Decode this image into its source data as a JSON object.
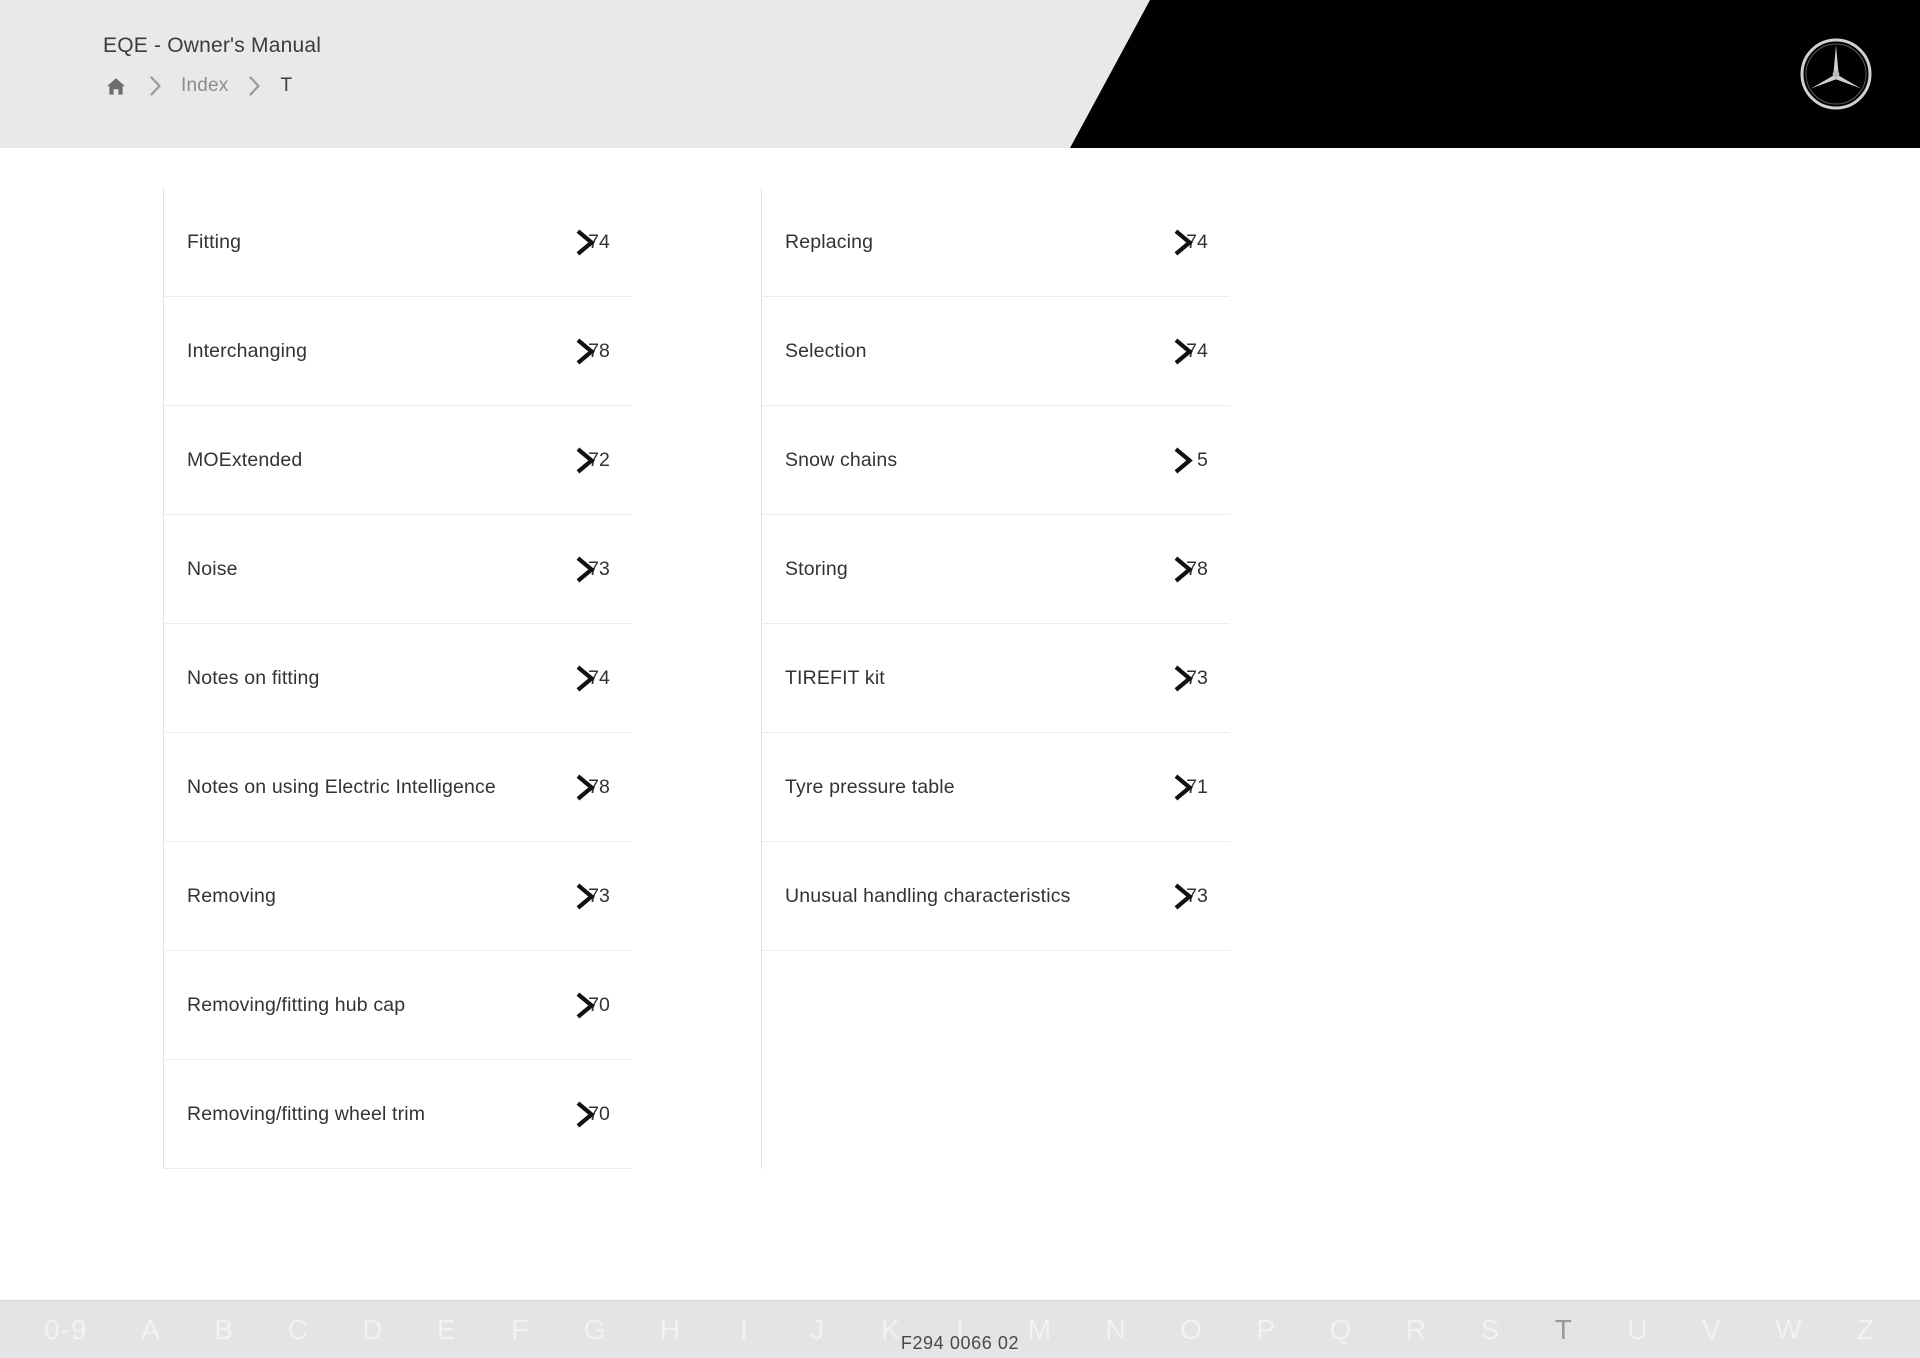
{
  "header": {
    "manual_title": "EQE - Owner's Manual",
    "breadcrumb": {
      "home_icon": "home-icon",
      "separator_icon": "chevron-right-icon",
      "index_label": "Index",
      "current_label": "T"
    },
    "logo": "mercedes-benz-star-logo"
  },
  "index": {
    "left_column": [
      {
        "label": "Fitting",
        "page": "74"
      },
      {
        "label": "Interchanging",
        "page": "78"
      },
      {
        "label": "MOExtended",
        "page": "72"
      },
      {
        "label": "Noise",
        "page": "73"
      },
      {
        "label": "Notes on fitting",
        "page": "74"
      },
      {
        "label": "Notes on using Electric Intelligence",
        "page": "78"
      },
      {
        "label": "Removing",
        "page": "73"
      },
      {
        "label": "Removing/fitting hub cap",
        "page": "70"
      },
      {
        "label": "Removing/fitting wheel trim",
        "page": "70"
      }
    ],
    "right_column": [
      {
        "label": "Replacing",
        "page": "74"
      },
      {
        "label": "Selection",
        "page": "74"
      },
      {
        "label": "Snow chains",
        "page": "5"
      },
      {
        "label": "Storing",
        "page": "78"
      },
      {
        "label": "TIREFIT kit",
        "page": "73"
      },
      {
        "label": "Tyre pressure table",
        "page": "71"
      },
      {
        "label": "Unusual handling characteristics",
        "page": "73"
      }
    ]
  },
  "footer": {
    "alphabet": [
      "0-9",
      "A",
      "B",
      "C",
      "D",
      "E",
      "F",
      "G",
      "H",
      "I",
      "J",
      "K",
      "L",
      "M",
      "N",
      "O",
      "P",
      "Q",
      "R",
      "S",
      "T",
      "U",
      "V",
      "W",
      "Z"
    ],
    "active_letter": "T",
    "document_code": "F294 0066 02"
  },
  "colors": {
    "header_bg": "#e9e9e9",
    "header_accent": "#010101",
    "text_primary": "#333333",
    "text_muted": "#8c8c8c",
    "divider": "#ececec",
    "footer_bg": "#e4e4e4"
  }
}
